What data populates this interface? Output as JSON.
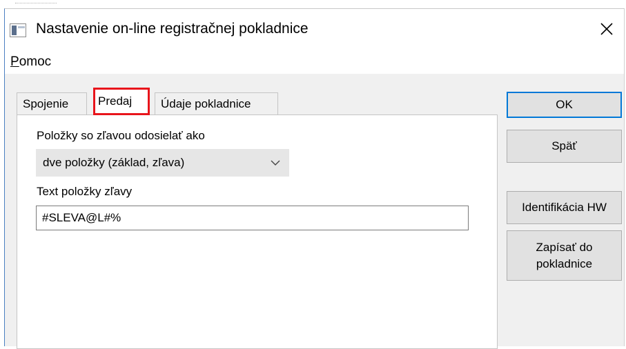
{
  "window": {
    "title": "Nastavenie on-line registračnej pokladnice"
  },
  "menu": {
    "help_hotkey": "P",
    "help_rest": "omoc"
  },
  "tabs": [
    {
      "label": "Spojenie",
      "active": false
    },
    {
      "label": "Predaj",
      "active": true
    },
    {
      "label": "Údaje pokladnice",
      "active": false
    }
  ],
  "form": {
    "discount_label": "Položky so zľavou odosielať ako",
    "discount_value": "dve položky (základ, zľava)",
    "text_label": "Text položky zľavy",
    "text_value": "#SLEVA@L#%"
  },
  "buttons": {
    "ok": "OK",
    "back": "Späť",
    "hw_id": "Identifikácia HW",
    "write_line1": "Zapísať do",
    "write_line2": "pokladnice"
  },
  "colors": {
    "highlight": "#e8141b",
    "focus": "#0078d7"
  }
}
